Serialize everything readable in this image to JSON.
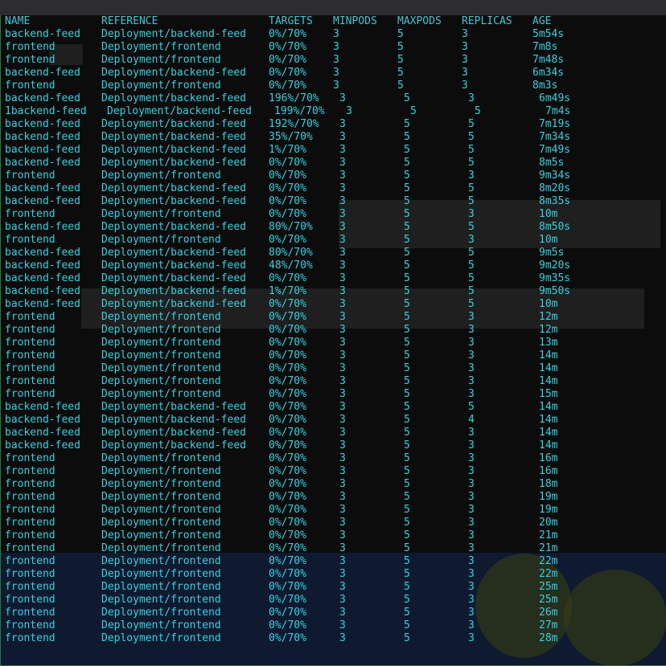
{
  "headers": [
    "NAME",
    "REFERENCE",
    "TARGETS",
    "MINPODS",
    "MAXPODS",
    "REPLICAS",
    "AGE"
  ],
  "rows": [
    [
      "backend-feed",
      "Deployment/backend-feed",
      "0%/70%",
      "3",
      "5",
      "3",
      "5m54s"
    ],
    [
      "frontend",
      "Deployment/frontend",
      "0%/70%",
      "3",
      "5",
      "3",
      "7m8s"
    ],
    [
      "frontend",
      "Deployment/frontend",
      "0%/70%",
      "3",
      "5",
      "3",
      "7m48s"
    ],
    [
      "backend-feed",
      "Deployment/backend-feed",
      "0%/70%",
      "3",
      "5",
      "3",
      "6m34s"
    ],
    [
      "frontend",
      "Deployment/frontend",
      "0%/70%",
      "3",
      "5",
      "3",
      "8m3s"
    ],
    [
      "backend-feed",
      "Deployment/backend-feed",
      "196%/70%",
      "3",
      "5",
      "3",
      "6m49s"
    ],
    [
      "1backend-feed",
      "Deployment/backend-feed",
      "199%/70%",
      "3",
      "5",
      "5",
      "7m4s"
    ],
    [
      "backend-feed",
      "Deployment/backend-feed",
      "192%/70%",
      "3",
      "5",
      "5",
      "7m19s"
    ],
    [
      "backend-feed",
      "Deployment/backend-feed",
      "35%/70%",
      "3",
      "5",
      "5",
      "7m34s"
    ],
    [
      "backend-feed",
      "Deployment/backend-feed",
      "1%/70%",
      "3",
      "5",
      "5",
      "7m49s"
    ],
    [
      "backend-feed",
      "Deployment/backend-feed",
      "0%/70%",
      "3",
      "5",
      "5",
      "8m5s"
    ],
    [
      "frontend",
      "Deployment/frontend",
      "0%/70%",
      "3",
      "5",
      "3",
      "9m34s"
    ],
    [
      "backend-feed",
      "Deployment/backend-feed",
      "0%/70%",
      "3",
      "5",
      "5",
      "8m20s"
    ],
    [
      "backend-feed",
      "Deployment/backend-feed",
      "0%/70%",
      "3",
      "5",
      "5",
      "8m35s"
    ],
    [
      "frontend",
      "Deployment/frontend",
      "0%/70%",
      "3",
      "5",
      "3",
      "10m"
    ],
    [
      "backend-feed",
      "Deployment/backend-feed",
      "80%/70%",
      "3",
      "5",
      "5",
      "8m50s"
    ],
    [
      "frontend",
      "Deployment/frontend",
      "0%/70%",
      "3",
      "5",
      "3",
      "10m"
    ],
    [
      "backend-feed",
      "Deployment/backend-feed",
      "80%/70%",
      "3",
      "5",
      "5",
      "9m5s"
    ],
    [
      "backend-feed",
      "Deployment/backend-feed",
      "48%/70%",
      "3",
      "5",
      "5",
      "9m20s"
    ],
    [
      "backend-feed",
      "Deployment/backend-feed",
      "0%/70%",
      "3",
      "5",
      "5",
      "9m35s"
    ],
    [
      "backend-feed",
      "Deployment/backend-feed",
      "1%/70%",
      "3",
      "5",
      "5",
      "9m50s"
    ],
    [
      "backend-feed",
      "Deployment/backend-feed",
      "0%/70%",
      "3",
      "5",
      "5",
      "10m"
    ],
    [
      "frontend",
      "Deployment/frontend",
      "0%/70%",
      "3",
      "5",
      "3",
      "12m"
    ],
    [
      "frontend",
      "Deployment/frontend",
      "0%/70%",
      "3",
      "5",
      "3",
      "12m"
    ],
    [
      "frontend",
      "Deployment/frontend",
      "0%/70%",
      "3",
      "5",
      "3",
      "13m"
    ],
    [
      "frontend",
      "Deployment/frontend",
      "0%/70%",
      "3",
      "5",
      "3",
      "14m"
    ],
    [
      "frontend",
      "Deployment/frontend",
      "0%/70%",
      "3",
      "5",
      "3",
      "14m"
    ],
    [
      "frontend",
      "Deployment/frontend",
      "0%/70%",
      "3",
      "5",
      "3",
      "14m"
    ],
    [
      "frontend",
      "Deployment/frontend",
      "0%/70%",
      "3",
      "5",
      "3",
      "15m"
    ],
    [
      "backend-feed",
      "Deployment/backend-feed",
      "0%/70%",
      "3",
      "5",
      "5",
      "14m"
    ],
    [
      "backend-feed",
      "Deployment/backend-feed",
      "0%/70%",
      "3",
      "5",
      "4",
      "14m"
    ],
    [
      "backend-feed",
      "Deployment/backend-feed",
      "0%/70%",
      "3",
      "5",
      "3",
      "14m"
    ],
    [
      "backend-feed",
      "Deployment/backend-feed",
      "0%/70%",
      "3",
      "5",
      "3",
      "14m"
    ],
    [
      "frontend",
      "Deployment/frontend",
      "0%/70%",
      "3",
      "5",
      "3",
      "16m"
    ],
    [
      "frontend",
      "Deployment/frontend",
      "0%/70%",
      "3",
      "5",
      "3",
      "16m"
    ],
    [
      "frontend",
      "Deployment/frontend",
      "0%/70%",
      "3",
      "5",
      "3",
      "18m"
    ],
    [
      "frontend",
      "Deployment/frontend",
      "0%/70%",
      "3",
      "5",
      "3",
      "19m"
    ],
    [
      "frontend",
      "Deployment/frontend",
      "0%/70%",
      "3",
      "5",
      "3",
      "19m"
    ],
    [
      "frontend",
      "Deployment/frontend",
      "0%/70%",
      "3",
      "5",
      "3",
      "20m"
    ],
    [
      "frontend",
      "Deployment/frontend",
      "0%/70%",
      "3",
      "5",
      "3",
      "21m"
    ],
    [
      "frontend",
      "Deployment/frontend",
      "0%/70%",
      "3",
      "5",
      "3",
      "21m"
    ],
    [
      "frontend",
      "Deployment/frontend",
      "0%/70%",
      "3",
      "5",
      "3",
      "22m"
    ],
    [
      "frontend",
      "Deployment/frontend",
      "0%/70%",
      "3",
      "5",
      "3",
      "22m"
    ],
    [
      "frontend",
      "Deployment/frontend",
      "0%/70%",
      "3",
      "5",
      "3",
      "25m"
    ],
    [
      "frontend",
      "Deployment/frontend",
      "0%/70%",
      "3",
      "5",
      "3",
      "25m"
    ],
    [
      "frontend",
      "Deployment/frontend",
      "0%/70%",
      "3",
      "5",
      "3",
      "26m"
    ],
    [
      "frontend",
      "Deployment/frontend",
      "0%/70%",
      "3",
      "5",
      "3",
      "27m"
    ],
    [
      "frontend",
      "Deployment/frontend",
      "0%/70%",
      "3",
      "5",
      "3",
      "28m"
    ]
  ]
}
